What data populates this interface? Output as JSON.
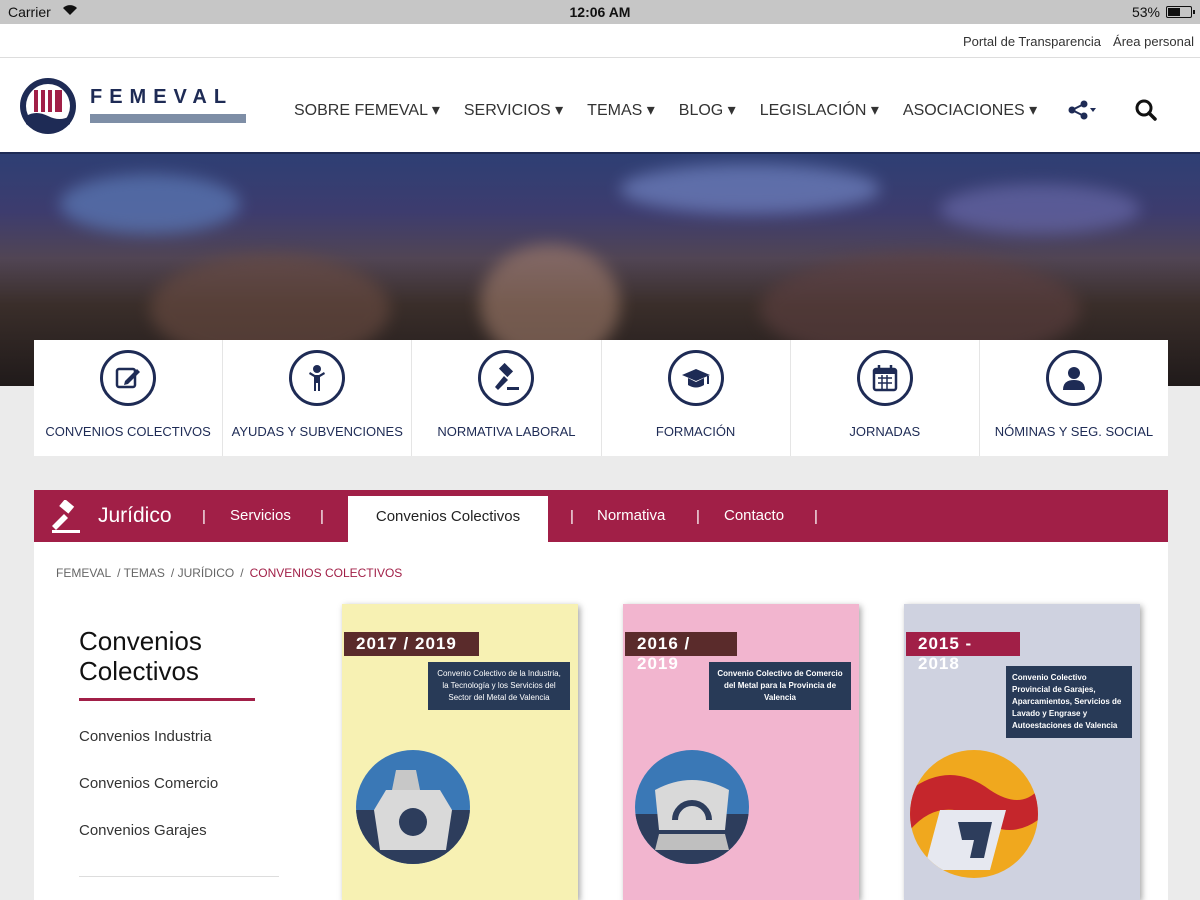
{
  "status_bar": {
    "carrier": "Carrier",
    "time": "12:06 AM",
    "battery": "53%",
    "battery_level": 0.53
  },
  "utility_links": [
    "Portal de Transparencia",
    "Área personal"
  ],
  "brand": {
    "name": "FEMEVAL",
    "primary": "#1e2b55",
    "accent": "#a11f47"
  },
  "nav": [
    "SOBRE FEMEVAL ▾",
    "SERVICIOS ▾",
    "TEMAS ▾",
    "BLOG ▾",
    "LEGISLACIÓN ▾",
    "ASOCIACIONES ▾"
  ],
  "nav_icons": [
    "share-icon",
    "search-icon"
  ],
  "categories": [
    {
      "label": "CONVENIOS COLECTIVOS",
      "icon": "edit-icon"
    },
    {
      "label": "AYUDAS Y SUBVENCIONES",
      "icon": "person-icon"
    },
    {
      "label": "NORMATIVA LABORAL",
      "icon": "gavel-icon"
    },
    {
      "label": "FORMACIÓN",
      "icon": "graduation-cap-icon"
    },
    {
      "label": "JORNADAS",
      "icon": "calendar-icon"
    },
    {
      "label": "NÓMINAS Y SEG. SOCIAL",
      "icon": "user-icon"
    }
  ],
  "section_tabs": {
    "section": "Jurídico",
    "tabs": [
      "Servicios",
      "Convenios Colectivos",
      "Normativa",
      "Contacto"
    ],
    "active": "Convenios Colectivos"
  },
  "breadcrumb": [
    "FEMEVAL",
    "/ TEMAS",
    "/ JURÍDICO",
    "/",
    "CONVENIOS COLECTIVOS"
  ],
  "sidebar": {
    "title": "Convenios Colectivos",
    "links": [
      "Convenios Industria",
      "Convenios Comercio",
      "Convenios Garajes"
    ]
  },
  "books": [
    {
      "year": "2017 / 2019",
      "title": "Convenio Colectivo de la Industria, la Tecnología y los Servicios del Sector del Metal de Valencia",
      "cover": "#f7f1b3",
      "band": "#5a2b2b"
    },
    {
      "year": "2016 / 2019",
      "title": "Convenio Colectivo de Comercio del Metal para la Provincia de Valencia",
      "cover": "#f2b5cf",
      "band": "#5a2b2b"
    },
    {
      "year": "2015 - 2018",
      "title": "Convenio Colectivo Provincial de Garajes, Aparcamientos, Servicios de Lavado y Engrase y Autoestaciones de Valencia",
      "cover": "#cfd2e0",
      "band": "#a11f47"
    }
  ]
}
